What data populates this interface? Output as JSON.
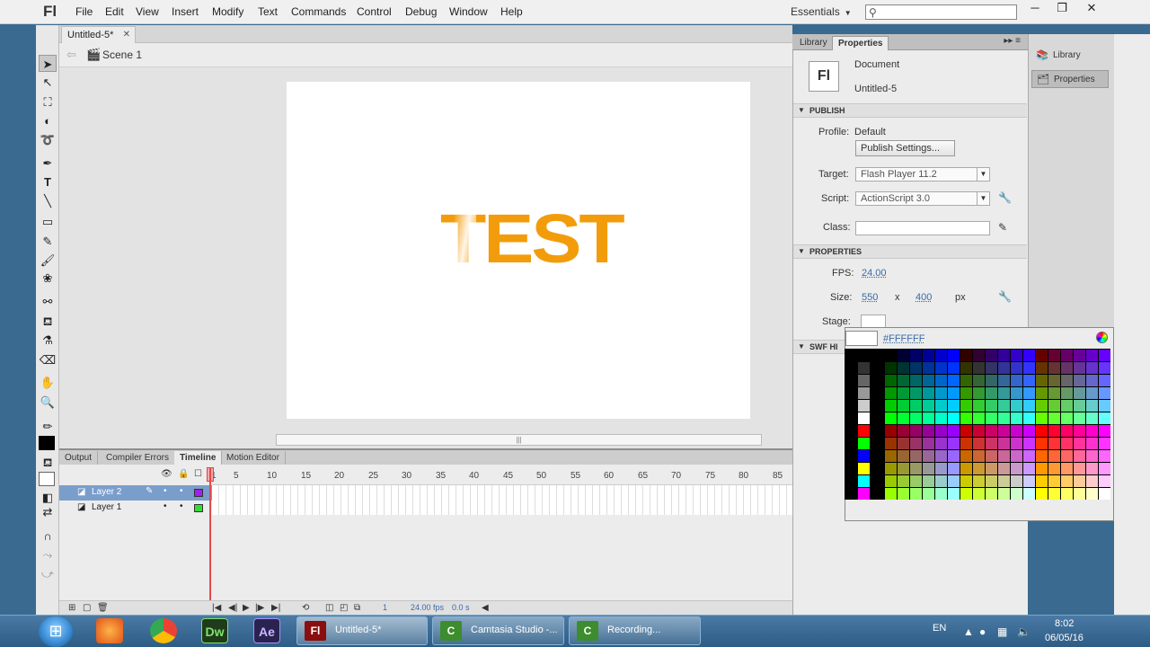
{
  "app": {
    "logo": "Fl",
    "menu": [
      "File",
      "Edit",
      "View",
      "Insert",
      "Modify",
      "Text",
      "Commands",
      "Control",
      "Debug",
      "Window",
      "Help"
    ],
    "workspace": "Essentials",
    "search_placeholder": "",
    "window_controls": [
      "─",
      "❐",
      "✕"
    ]
  },
  "document": {
    "tab": "Untitled-5*",
    "scene": "Scene 1",
    "stage_text": "TEST",
    "stage_text_color": "#f39c0b",
    "stage_color": "#ffffff"
  },
  "timeline": {
    "tabs": [
      "Output",
      "Compiler Errors",
      "Timeline",
      "Motion Editor"
    ],
    "active_tab": "Timeline",
    "layers": [
      {
        "name": "Layer 2",
        "selected": true,
        "color": "#a020f0"
      },
      {
        "name": "Layer 1",
        "selected": false,
        "color": "#33dd33"
      }
    ],
    "frame_numbers": [
      "1",
      "5",
      "10",
      "15",
      "20",
      "25",
      "30",
      "35",
      "40",
      "45",
      "50",
      "55",
      "60",
      "65",
      "70",
      "75",
      "80",
      "85"
    ],
    "current_frame": "1",
    "fps": "24.00 fps",
    "time": "0.0 s"
  },
  "properties": {
    "tabs": [
      "Library",
      "Properties"
    ],
    "active_tab": "Properties",
    "doc_icon": "Fl",
    "doc_type": "Document",
    "doc_name": "Untitled-5",
    "publish": {
      "header": "PUBLISH",
      "profile_label": "Profile:",
      "profile_value": "Default",
      "settings_button": "Publish Settings...",
      "target_label": "Target:",
      "target_value": "Flash Player 11.2",
      "script_label": "Script:",
      "script_value": "ActionScript 3.0",
      "class_label": "Class:",
      "class_value": ""
    },
    "props": {
      "header": "PROPERTIES",
      "fps_label": "FPS:",
      "fps_value": "24.00",
      "size_label": "Size:",
      "width": "550",
      "x": "x",
      "height": "400",
      "unit": "px",
      "stage_label": "Stage:"
    },
    "swf_header": "SWF HI"
  },
  "swatch_popup": {
    "hex": "#FFFFFF"
  },
  "right_dock": [
    "Library",
    "Properties"
  ],
  "taskbar": {
    "apps": [
      {
        "label": "",
        "icon": "firefox-icon"
      },
      {
        "label": "",
        "icon": "chrome-icon"
      },
      {
        "label": "Dw",
        "icon": "dreamweaver-icon"
      },
      {
        "label": "Ae",
        "icon": "after-effects-icon"
      }
    ],
    "tasks": [
      {
        "label": "Untitled-5*",
        "icon": "Fl"
      },
      {
        "label": "Camtasia Studio -...",
        "icon": "C"
      },
      {
        "label": "Recording...",
        "icon": "C"
      }
    ],
    "lang": "EN",
    "time": "8:02",
    "date": "06/05/16"
  }
}
